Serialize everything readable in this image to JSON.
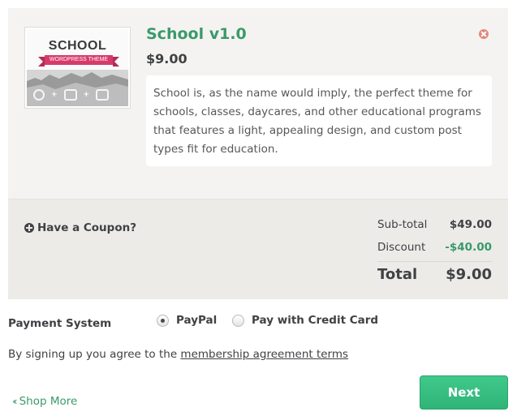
{
  "cart_item": {
    "thumbnail": {
      "title": "SCHOOL",
      "ribbon": "WORDPRESS THEME",
      "icons": [
        "wordpress-icon",
        "devices-icon",
        "photoshop-icon"
      ]
    },
    "title": "School v1.0",
    "price": "$9.00",
    "description": "School is, as the name would imply, the perfect theme for schools, classes, daycares, and other educational programs that features a light, appealing design, and custom post types fit for education.",
    "remove_icon": "close-circle-icon"
  },
  "totals": {
    "coupon_label": "Have a Coupon?",
    "subtotal_label": "Sub-total",
    "subtotal_value": "$49.00",
    "discount_label": "Discount",
    "discount_value": "-$40.00",
    "total_label": "Total",
    "total_value": "$9.00"
  },
  "payment": {
    "label": "Payment System",
    "options": [
      {
        "label": "PayPal",
        "selected": true
      },
      {
        "label": "Pay with Credit Card",
        "selected": false
      }
    ]
  },
  "agreement": {
    "prefix": "By signing up you agree to the ",
    "link": "membership agreement terms"
  },
  "footer": {
    "shop_more": "Shop More",
    "next": "Next"
  },
  "colors": {
    "accent_green": "#3a9a6a",
    "button_green": "#34bb7c",
    "panel_bg": "#f4f3f1",
    "totals_bg": "#ecebe8"
  }
}
